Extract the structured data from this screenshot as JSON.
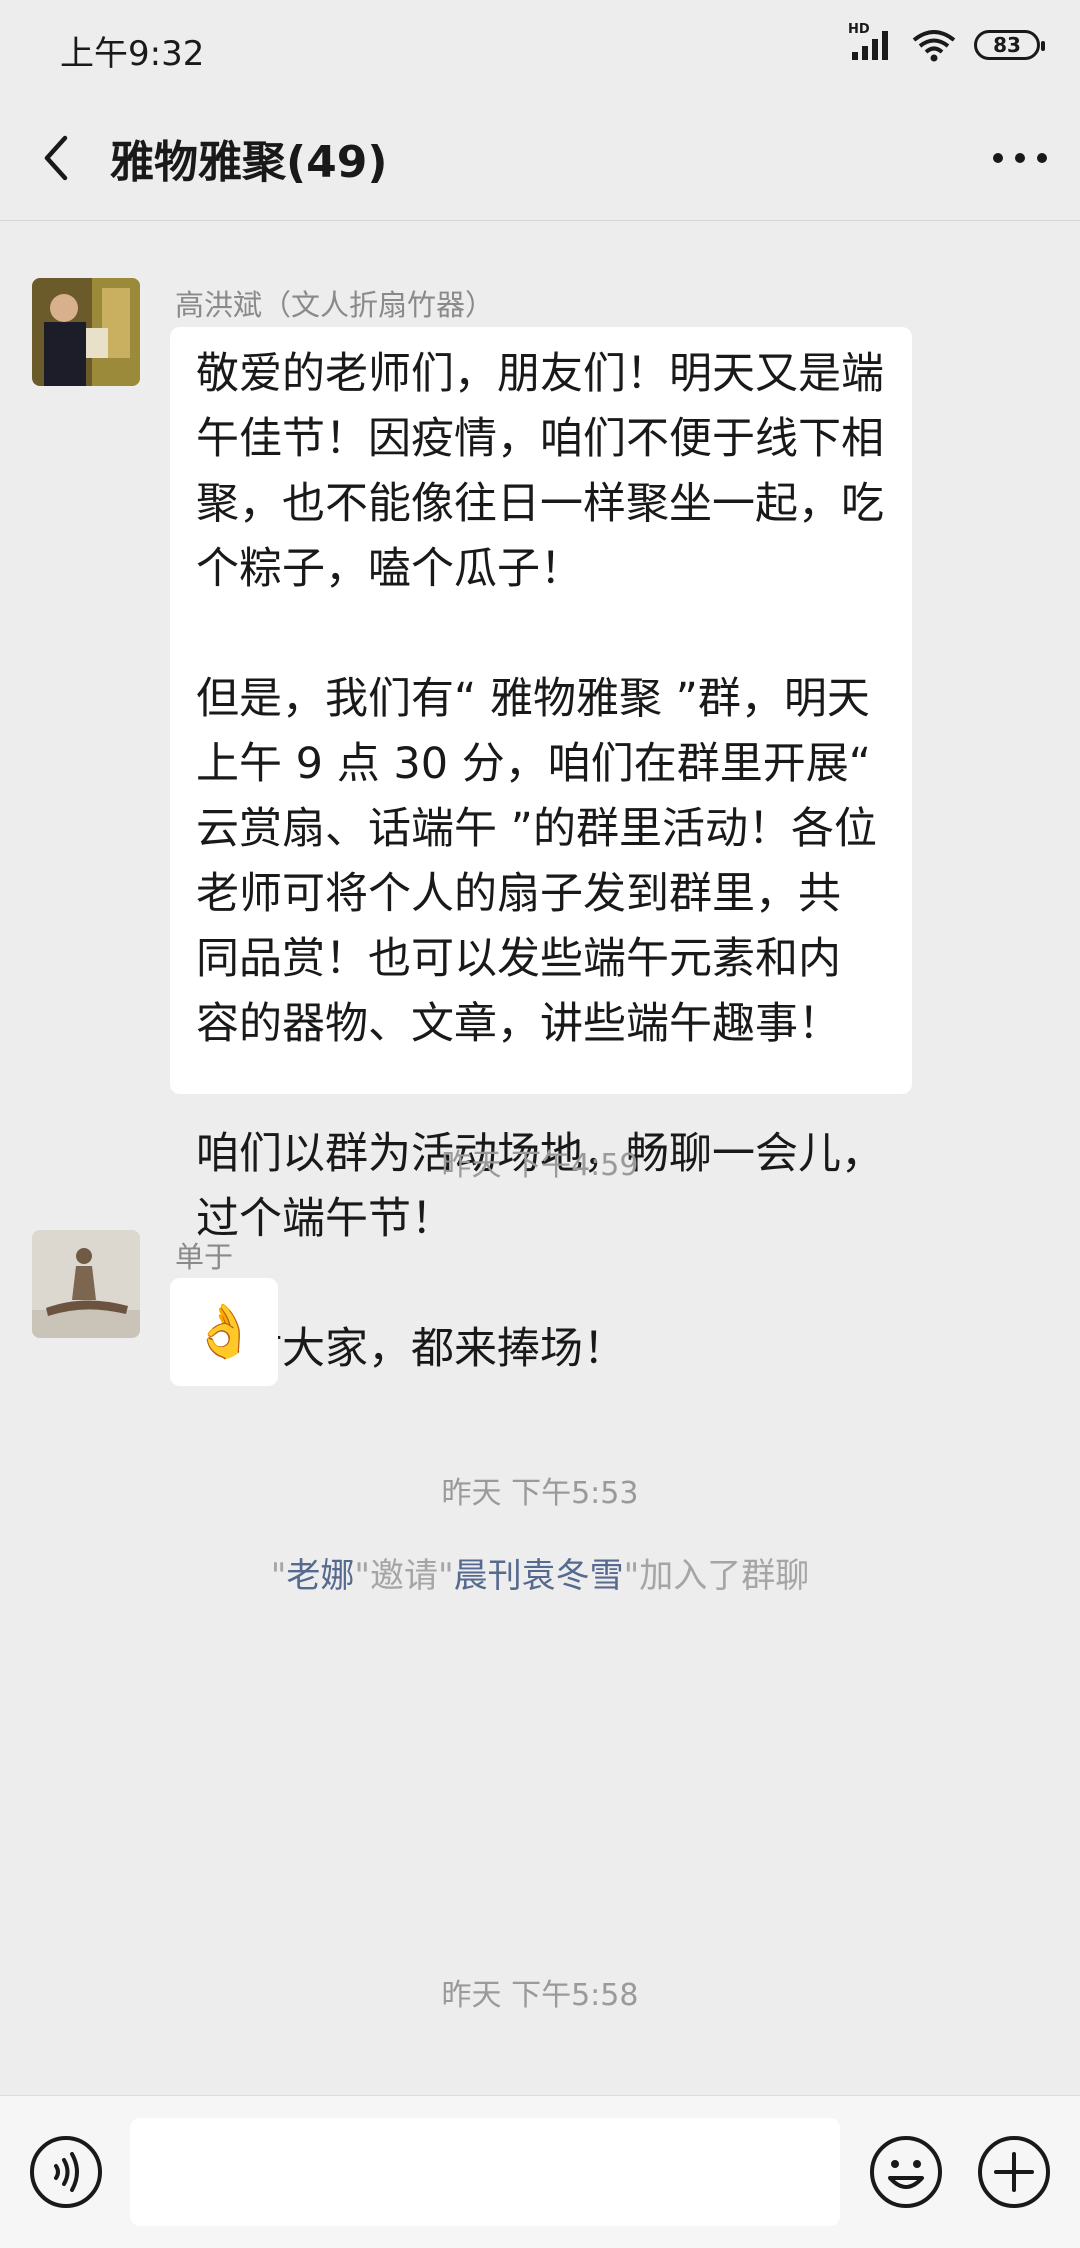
{
  "status_bar": {
    "time": "上午9:32",
    "network_badge": "HD",
    "battery": "83"
  },
  "header": {
    "title": "雅物雅聚(49)"
  },
  "messages": [
    {
      "kind": "text",
      "sender": "高洪斌（文人折扇竹器）",
      "text": "敬爱的老师们，朋友们！明天又是端\n午佳节！因疫情，咱们不便于线下相\n聚，也不能像往日一样聚坐一起，吃\n个粽子，嗑个瓜子！\n\n但是，我们有“ 雅物雅聚 ”群，明天\n上午 9 点 30 分，咱们在群里开展“\n云赏扇、话端午 ”的群里活动！各位\n老师可将个人的扇子发到群里，共\n同品赏！也可以发些端午元素和内\n容的器物、文章，讲些端午趣事！\n\n咱们以群为活动场地，畅聊一会儿，\n过个端午节！\n\n感谢大家，都来捧场！"
    },
    {
      "kind": "time",
      "text": "昨天 下午4:59"
    },
    {
      "kind": "emoji",
      "sender": "单于",
      "emoji": "👌"
    },
    {
      "kind": "time",
      "text": "昨天 下午5:53"
    },
    {
      "kind": "system",
      "quote_open_1": "\"",
      "inviter": "老娜",
      "quote_close_1": "\"",
      "verb": "邀请",
      "quote_open_2": "\"",
      "invitee": "晨刊袁冬雪",
      "quote_close_2": "\"",
      "suffix": "加入了群聊"
    },
    {
      "kind": "time",
      "text": "昨天 下午5:58"
    }
  ],
  "input": {
    "placeholder": ""
  },
  "icons": {
    "back": "chevron-left-icon",
    "more": "more-dots-icon",
    "voice": "voice-icon",
    "emoji": "smiley-icon",
    "plus": "plus-circle-icon"
  },
  "colors": {
    "background": "#ededed",
    "bubble": "#ffffff",
    "system_link": "#56698f",
    "meta_text": "#9a9a9a"
  }
}
